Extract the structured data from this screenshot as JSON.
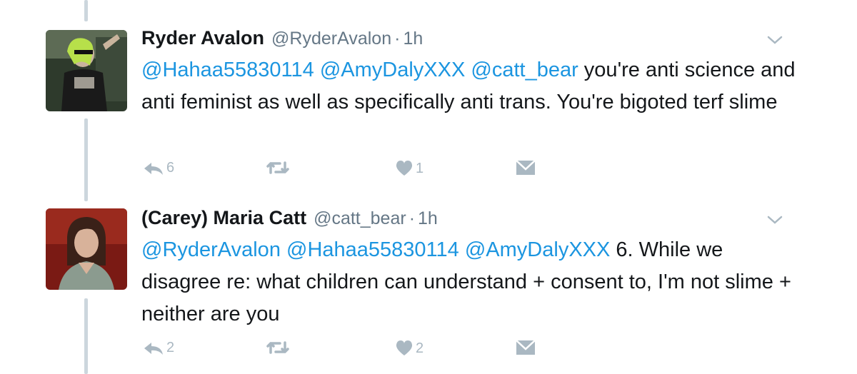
{
  "colors": {
    "mention": "#1b95e0",
    "muted": "#657786",
    "action": "#aab8c2",
    "thread_line": "#ccd6dd"
  },
  "tweets": [
    {
      "name": "Ryder Avalon",
      "handle": "@RyderAvalon",
      "separator": "·",
      "time": "1h",
      "body": [
        {
          "type": "mention",
          "text": "@Hahaa55830114"
        },
        {
          "type": "text",
          "text": " "
        },
        {
          "type": "mention",
          "text": "@AmyDalyXXX"
        },
        {
          "type": "text",
          "text": " "
        },
        {
          "type": "mention",
          "text": "@catt_bear"
        },
        {
          "type": "text",
          "text": " you're anti science and anti feminist as well as specifically anti trans. You're bigoted terf slime"
        }
      ],
      "reply_count": "6",
      "retweet_count": "",
      "like_count": "1"
    },
    {
      "name": "(Carey) Maria Catt",
      "handle": "@catt_bear",
      "separator": "·",
      "time": "1h",
      "body": [
        {
          "type": "mention",
          "text": "@RyderAvalon"
        },
        {
          "type": "text",
          "text": " "
        },
        {
          "type": "mention",
          "text": "@Hahaa55830114"
        },
        {
          "type": "text",
          "text": " "
        },
        {
          "type": "mention",
          "text": "@AmyDalyXXX"
        },
        {
          "type": "text",
          "text": " 6. While we disagree re: what children can understand + consent to, I'm not slime + neither are you"
        }
      ],
      "reply_count": "2",
      "retweet_count": "",
      "like_count": "2"
    }
  ]
}
